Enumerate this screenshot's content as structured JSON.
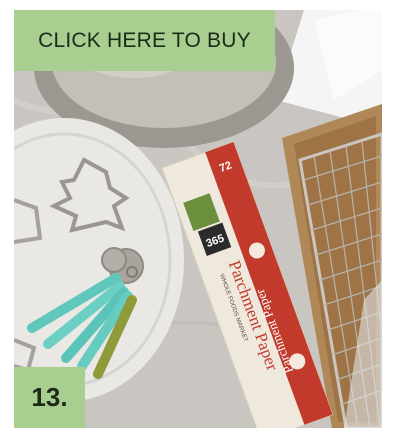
{
  "colors": {
    "banner_bg": "#a8cf8f",
    "banner_text": "#1d2a1a",
    "marble": "#c9c6c1",
    "plate": "#e9e8e4",
    "steel": "#b7b2ab",
    "box": "#efe8dc",
    "box_red": "#c23a2c",
    "tray": "#b08858",
    "teal": "#5fc7bb",
    "olive": "#8f9a3a"
  },
  "banner": {
    "label": "CLICK HERE TO BUY"
  },
  "badge": {
    "label": "13."
  },
  "product": {
    "logo_number": "365",
    "brand": "WHOLE FOODS MARKET",
    "name": "Parchment Paper",
    "name_rev": "Parchment Paper",
    "footage": "72"
  }
}
